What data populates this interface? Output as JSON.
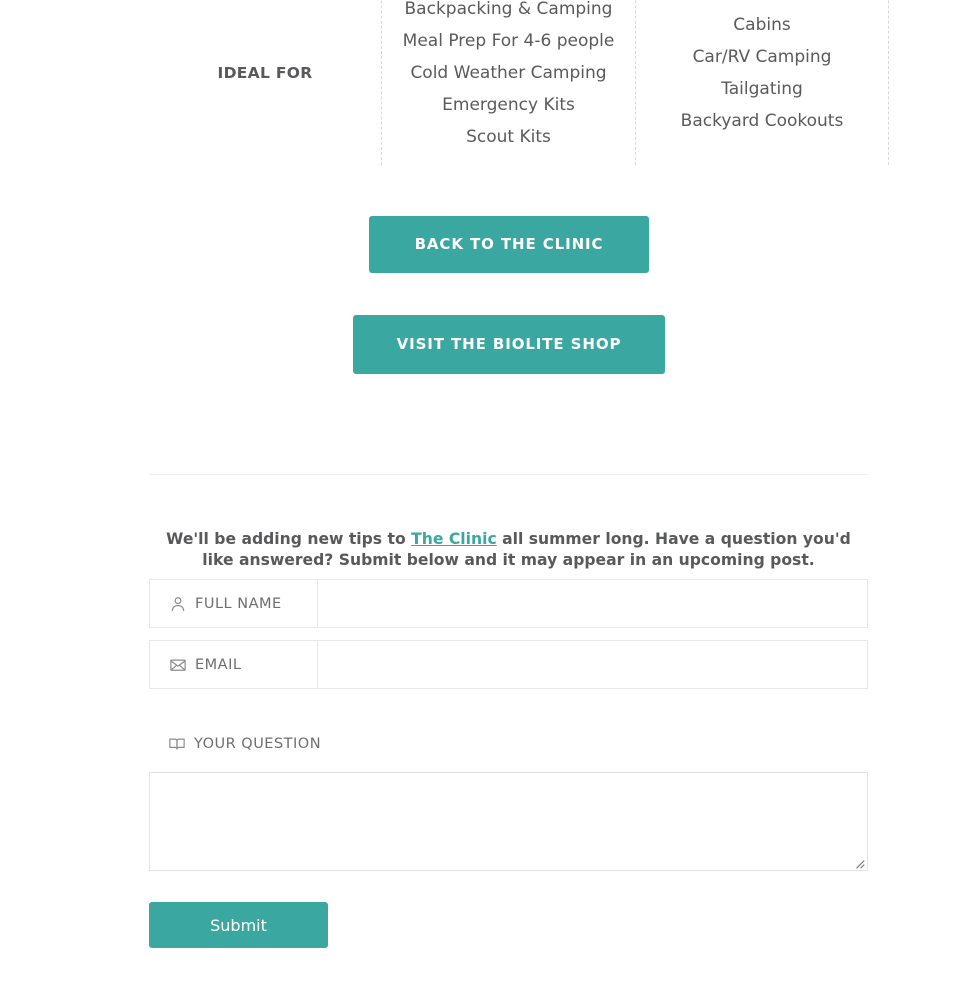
{
  "comparison": {
    "row_label": "IDEAL FOR",
    "columns": [
      {
        "items": [
          "Backpacking & Camping",
          "Meal Prep For 4-6 people",
          "Cold Weather Camping",
          "Emergency Kits",
          "Scout Kits"
        ]
      },
      {
        "items": [
          "Cabins",
          "Car/RV Camping",
          "Tailgating",
          "Backyard Cookouts"
        ]
      }
    ]
  },
  "cta": {
    "clinic_label": "BACK TO THE CLINIC",
    "shop_label": "VISIT THE BIOLITE SHOP"
  },
  "intro": {
    "text_before": "We'll be adding new tips to ",
    "link_text": "The Clinic",
    "text_after": " all summer long. Have a question you'd like answered? Submit below and it may appear in an upcoming post."
  },
  "form": {
    "fields": [
      {
        "icon": "user-icon",
        "label": "FULL NAME",
        "value": "",
        "placeholder": ""
      },
      {
        "icon": "envelope-icon",
        "label": "EMAIL",
        "value": "",
        "placeholder": ""
      }
    ],
    "question": {
      "icon": "book-icon",
      "label": "YOUR QUESTION",
      "value": "",
      "placeholder": ""
    },
    "submit_label": "Submit"
  },
  "colors": {
    "accent": "#3ba7a1",
    "text": "#58595b",
    "border": "#e8e8e8",
    "dashed": "#d8d8d8"
  }
}
